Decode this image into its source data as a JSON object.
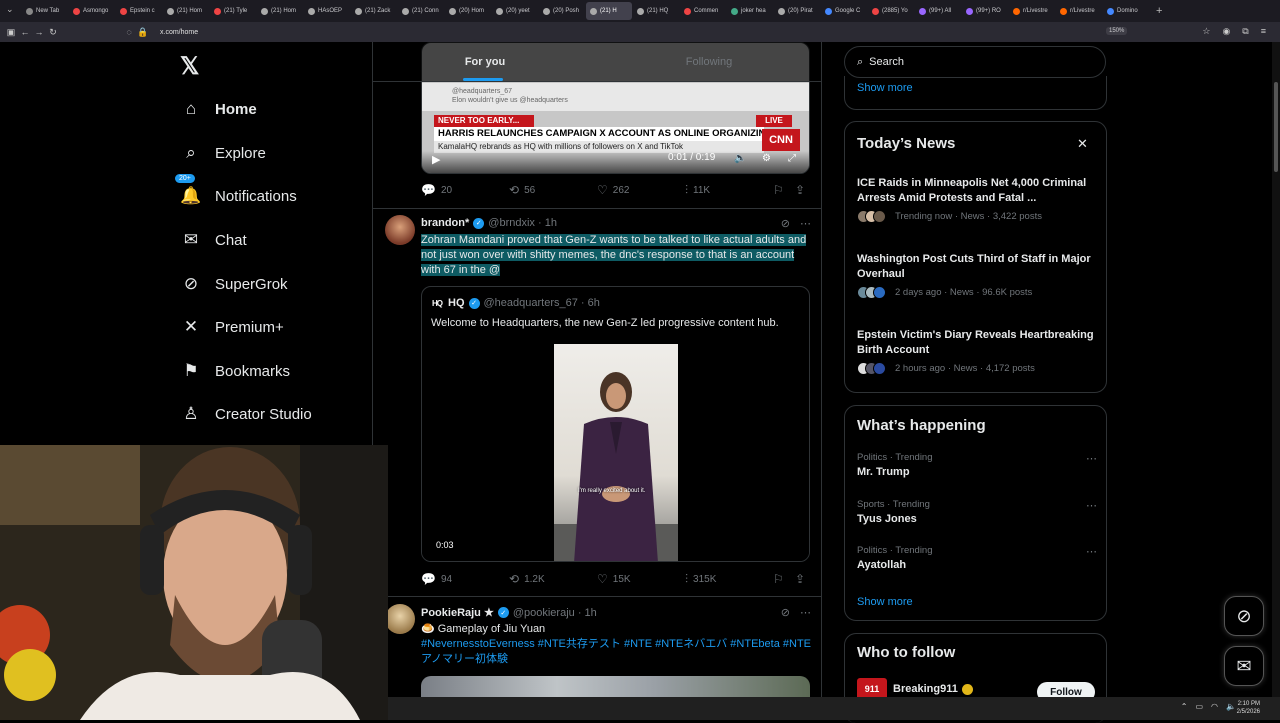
{
  "browser": {
    "tabs": [
      {
        "label": "New Tab",
        "color": "#888"
      },
      {
        "label": "Asmongo",
        "color": "#e44"
      },
      {
        "label": "Epstein c",
        "color": "#e44"
      },
      {
        "label": "(21) Hom",
        "color": "#aaa"
      },
      {
        "label": "(21) Tyle",
        "color": "#e44"
      },
      {
        "label": "(21) Hom",
        "color": "#aaa"
      },
      {
        "label": "HAsOEP",
        "color": "#aaa"
      },
      {
        "label": "(21) Zack",
        "color": "#aaa"
      },
      {
        "label": "(21) Conn",
        "color": "#aaa"
      },
      {
        "label": "(20) Hom",
        "color": "#aaa"
      },
      {
        "label": "(20) yeet",
        "color": "#aaa"
      },
      {
        "label": "(20) Posh",
        "color": "#aaa"
      },
      {
        "label": "(21) H",
        "color": "#aaa",
        "active": true
      },
      {
        "label": "(21) HQ",
        "color": "#aaa"
      },
      {
        "label": "Commen",
        "color": "#e44"
      },
      {
        "label": "joker hea",
        "color": "#4a8"
      },
      {
        "label": "(20) Pirat",
        "color": "#aaa"
      },
      {
        "label": "Google C",
        "color": "#48f"
      },
      {
        "label": "(2885) Yo",
        "color": "#e44"
      },
      {
        "label": "(99+) All",
        "color": "#96f"
      },
      {
        "label": "(99+) RO",
        "color": "#96f"
      },
      {
        "label": "r/Livestre",
        "color": "#f60"
      },
      {
        "label": "r/Livestre",
        "color": "#f60"
      },
      {
        "label": "Domino",
        "color": "#48f"
      }
    ],
    "new_tab": "+",
    "url": "x.com/home",
    "zoom": "150%"
  },
  "nav": {
    "logo": "𝕏",
    "items": [
      {
        "label": "Home",
        "icon": "home-icon",
        "glyph": "⌂"
      },
      {
        "label": "Explore",
        "icon": "search-icon",
        "glyph": "⌕"
      },
      {
        "label": "Notifications",
        "icon": "bell-icon",
        "glyph": "🔔",
        "badge": "20+"
      },
      {
        "label": "Chat",
        "icon": "mail-icon",
        "glyph": "✉"
      },
      {
        "label": "SuperGrok",
        "icon": "grok-icon",
        "glyph": "⊘"
      },
      {
        "label": "Premium+",
        "icon": "x-icon",
        "glyph": "✕"
      },
      {
        "label": "Bookmarks",
        "icon": "bookmark-icon",
        "glyph": "⚑"
      },
      {
        "label": "Creator Studio",
        "icon": "creator-icon",
        "glyph": "♙"
      }
    ]
  },
  "feed": {
    "tabs": [
      "For you",
      "Following"
    ],
    "tweet1": {
      "video_source": "@headquarters_67",
      "video_text1": "Elon wouldn't give us @headquarters",
      "video_banner": "NEVER TOO EARLY...",
      "video_live": "LIVE",
      "video_headline": "HARRIS RELAUNCHES CAMPAIGN X ACCOUNT AS ONLINE ORGANIZING TOOL",
      "video_sub": "KamalaHQ rebrands as HQ with millions of followers on X and TikTok",
      "video_brand": "CNN",
      "video_time": "0:01 / 0:19",
      "replies": "20",
      "reposts": "56",
      "likes": "262",
      "views": "11K"
    },
    "tweet2": {
      "name": "brandon*",
      "handle": "@brndxix",
      "time": "1h",
      "text": "Zohran Mamdani proved that Gen-Z wants to be talked to like actual adults and not just won over with shitty memes, the dnc's response to that is an account with 67 in the @",
      "quote_logo": "HQ",
      "quote_name": "HQ",
      "quote_handle": "@headquarters_67",
      "quote_time": "6h",
      "quote_text": "Welcome to Headquarters, the new Gen-Z led progressive content hub.",
      "quote_caption": "I'm really excited about it.",
      "quote_video_time": "0:03",
      "replies": "94",
      "reposts": "1.2K",
      "likes": "15K",
      "views": "315K"
    },
    "tweet3": {
      "name": "PookieRaju ★",
      "handle": "@pookieraju",
      "time": "1h",
      "line1": "🍮 Gameplay of Jiu Yuan",
      "hashtags": "#NevernesstoEverness #NTE共存テスト #NTE #NTEネバエバ #NTEbeta #NTEアノマリー初体験"
    }
  },
  "right": {
    "search_placeholder": "Search",
    "show_more": "Show more",
    "news": {
      "title": "Today’s News",
      "close": "✕",
      "items": [
        {
          "title": "ICE Raids in Minneapolis Net 4,000 Criminal Arrests Amid Protests and Fatal ...",
          "meta": "Trending now · News · 3,422 posts"
        },
        {
          "title": "Washington Post Cuts Third of Staff in Major Overhaul",
          "meta": "2 days ago · News · 96.6K posts"
        },
        {
          "title": "Epstein Victim's Diary Reveals Heartbreaking Birth Account",
          "meta": "2 hours ago · News · 4,172 posts"
        }
      ]
    },
    "happening": {
      "title": "What’s happening",
      "items": [
        {
          "cat": "Politics · Trending",
          "name": "Mr. Trump"
        },
        {
          "cat": "Sports · Trending",
          "name": "Tyus Jones"
        },
        {
          "cat": "Politics · Trending",
          "name": "Ayatollah"
        }
      ],
      "show_more": "Show more"
    },
    "follow": {
      "title": "Who to follow",
      "name": "Breaking911",
      "button": "Follow"
    }
  },
  "taskbar": {
    "time": "2:10 PM",
    "date": "2/5/2026"
  }
}
